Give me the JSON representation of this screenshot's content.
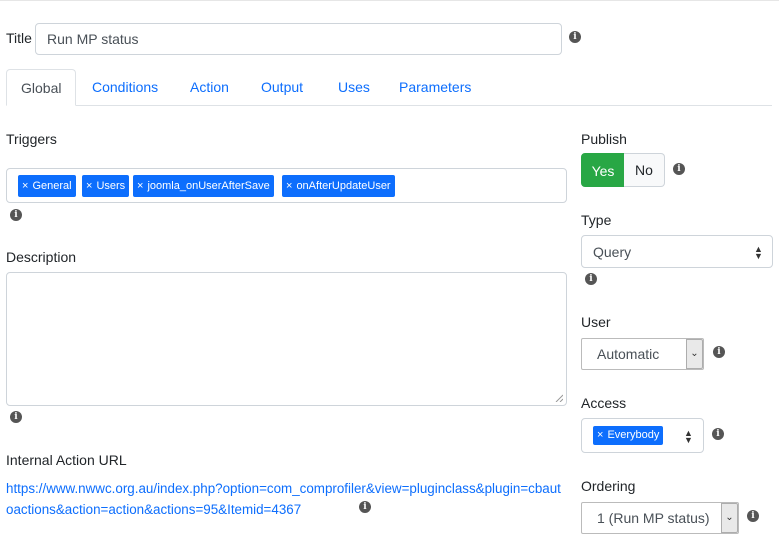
{
  "title_field": {
    "label": "Title",
    "value": "Run MP status"
  },
  "tabs": [
    {
      "label": "Global",
      "active": true
    },
    {
      "label": "Conditions"
    },
    {
      "label": "Action"
    },
    {
      "label": "Output"
    },
    {
      "label": "Uses"
    },
    {
      "label": "Parameters"
    }
  ],
  "triggers": {
    "label": "Triggers",
    "tags": [
      "General",
      "Users",
      "joomla_onUserAfterSave",
      "onAfterUpdateUser"
    ],
    "remove_glyph": "×"
  },
  "description": {
    "label": "Description",
    "value": ""
  },
  "internal_url": {
    "label": "Internal Action URL",
    "url": "https://www.nwwc.org.au/index.php?option=com_comprofiler&view=pluginclass&plugin=cbautoactions&action=action&actions=95&Itemid=4367"
  },
  "publish": {
    "label": "Publish",
    "yes_label": "Yes",
    "no_label": "No",
    "selected": "Yes"
  },
  "type": {
    "label": "Type",
    "value": "Query"
  },
  "user": {
    "label": "User",
    "value": "Automatic"
  },
  "access": {
    "label": "Access",
    "tag": "Everybody"
  },
  "ordering": {
    "label": "Ordering",
    "value": "1 (Run MP status)"
  },
  "info_glyph": "i",
  "colors": {
    "accent": "#0d6efd",
    "success": "#28a745",
    "border": "#ced4da",
    "tab_border": "#dee2e6"
  }
}
